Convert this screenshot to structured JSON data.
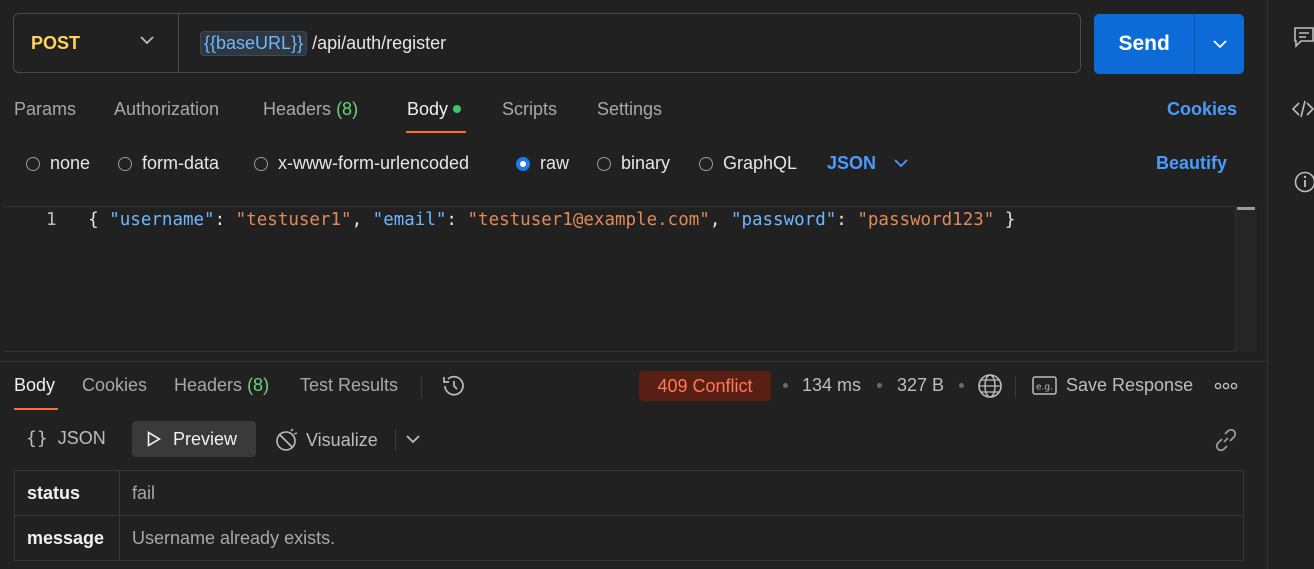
{
  "request": {
    "method": "POST",
    "url_variable": "{{baseURL}}",
    "url_path": "/api/auth/register",
    "send_label": "Send"
  },
  "request_tabs": {
    "params": "Params",
    "authorization": "Authorization",
    "headers": "Headers",
    "headers_count": "(8)",
    "body": "Body",
    "scripts": "Scripts",
    "settings": "Settings",
    "cookies": "Cookies"
  },
  "body_types": {
    "none": "none",
    "form_data": "form-data",
    "urlencoded": "x-www-form-urlencoded",
    "raw": "raw",
    "binary": "binary",
    "graphql": "GraphQL",
    "selected": "raw",
    "language": "JSON",
    "beautify": "Beautify"
  },
  "editor": {
    "line_number": "1",
    "code": {
      "open": "{ ",
      "k1": "\"username\"",
      "v1": "\"testuser1\"",
      "k2": "\"email\"",
      "v2": "\"testuser1@example.com\"",
      "k3": "\"password\"",
      "v3": "\"password123\"",
      "colon": ": ",
      "comma": ", ",
      "close": " }"
    }
  },
  "response_tabs": {
    "body": "Body",
    "cookies": "Cookies",
    "headers": "Headers",
    "headers_count": "(8)",
    "test_results": "Test Results"
  },
  "response_meta": {
    "status": "409 Conflict",
    "time": "134 ms",
    "size": "327 B",
    "save_response": "Save Response",
    "colors": {
      "status_bg": "#5a1f14",
      "status_text": "#ff7a59"
    }
  },
  "response_view": {
    "json": "JSON",
    "preview": "Preview",
    "visualize": "Visualize"
  },
  "response_table": [
    {
      "key": "status",
      "value": "fail"
    },
    {
      "key": "message",
      "value": "Username already exists."
    }
  ],
  "colors": {
    "accent": "#ff6c37",
    "link": "#4b9bff",
    "send": "#0c6bd6",
    "method": "#ffd458"
  }
}
